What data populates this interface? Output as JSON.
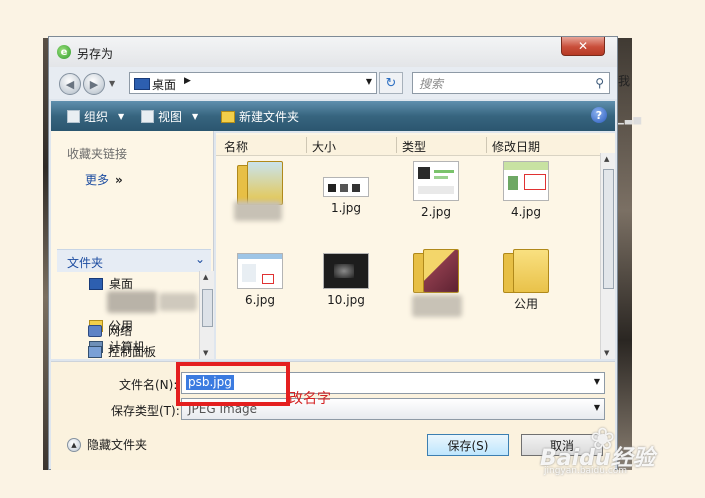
{
  "window": {
    "title": "另存为",
    "close_label": "✕"
  },
  "address": {
    "location": "桌面",
    "search_placeholder": "搜索"
  },
  "toolbar": {
    "organize": "组织",
    "views": "视图",
    "new_folder": "新建文件夹",
    "help": "?"
  },
  "navpane": {
    "favorites_header": "收藏夹链接",
    "more_label": "更多",
    "folders_header": "文件夹",
    "tree": [
      "桌面",
      "公用",
      "计算机",
      "网络",
      "控制面板"
    ]
  },
  "columns": [
    "名称",
    "大小",
    "类型",
    "修改日期"
  ],
  "files": [
    "1.jpg",
    "2.jpg",
    "4.jpg",
    "6.jpg",
    "10.jpg",
    "公用"
  ],
  "form": {
    "filename_label": "文件名(N):",
    "filename_value": "psb.jpg",
    "type_label": "保存类型(T):",
    "type_value": "JPEG Image",
    "hide_folders": "隐藏文件夹",
    "save": "保存(S)",
    "cancel": "取消"
  },
  "annotation": {
    "text": "改名字",
    "color": "#e41f1f"
  },
  "background": {
    "right_text": "我"
  },
  "watermark": {
    "brand": "Baidu经验",
    "sub": "jingyan.baidu.com"
  }
}
